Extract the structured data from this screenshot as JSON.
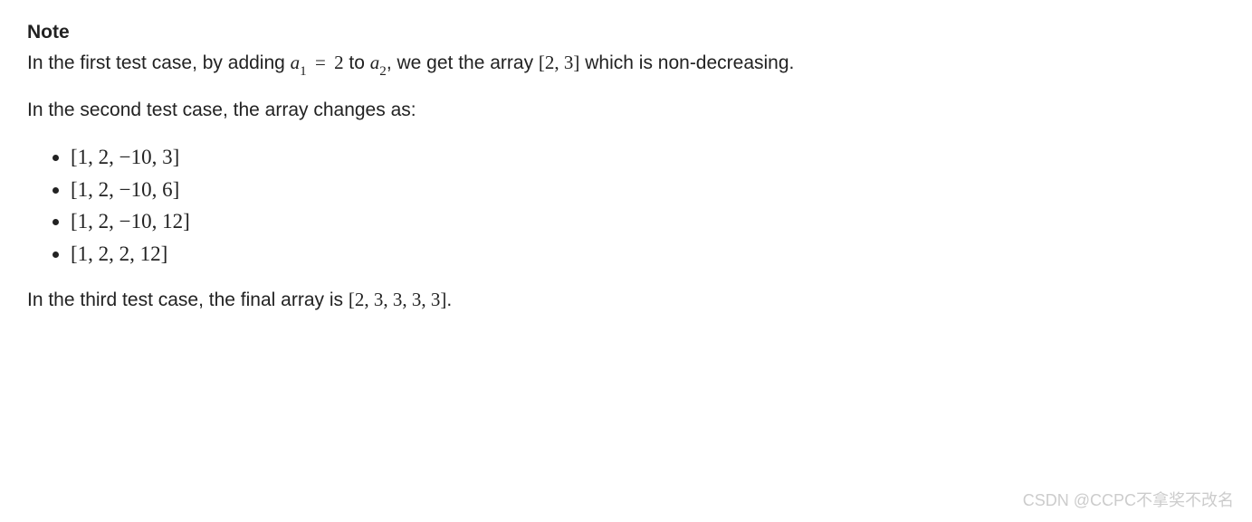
{
  "note": {
    "title": "Note",
    "p1_a": "In the first test case, by adding ",
    "p1_a1": "a",
    "p1_sub1": "1",
    "p1_eq": " = ",
    "p1_val": "2",
    "p1_b": " to ",
    "p1_a2": "a",
    "p1_sub2": "2",
    "p1_c": ", we get the array ",
    "p1_arr": "[2, 3]",
    "p1_d": " which is non-decreasing.",
    "p2": "In the second test case, the array changes as:",
    "list": [
      "[1, 2, −10, 3]",
      "[1, 2, −10, 6]",
      "[1, 2, −10, 12]",
      "[1, 2, 2, 12]"
    ],
    "p3_a": "In the third test case, the final array is ",
    "p3_arr": "[2, 3, 3, 3, 3]",
    "p3_b": "."
  },
  "watermark": "CSDN @CCPC不拿奖不改名"
}
